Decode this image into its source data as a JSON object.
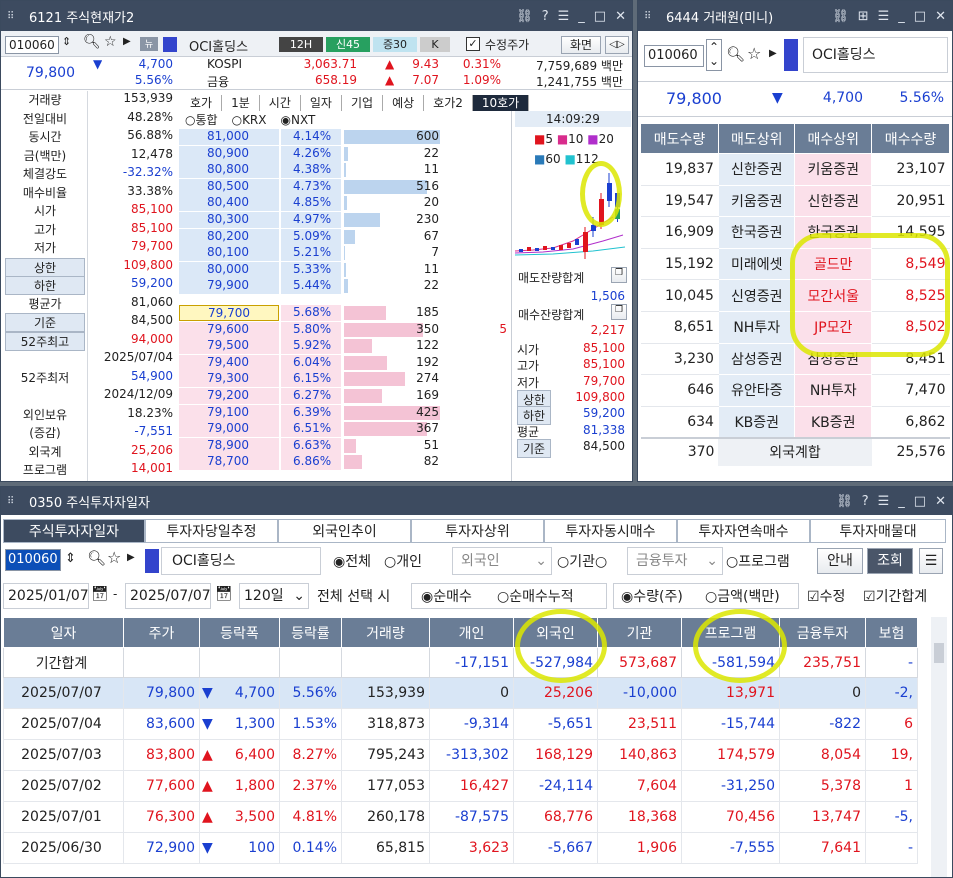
{
  "win1": {
    "title": "6121 주식현재가2",
    "code": "010060",
    "name": "OCI홀딩스",
    "tags": [
      "12H",
      "신45",
      "증30",
      "K"
    ],
    "adj_label": "수정주가",
    "screen_label": "화면",
    "price": "79,800",
    "change": "4,700",
    "change_rate": "5.56%",
    "index_rows": [
      {
        "name": "KOSPI",
        "value": "3,063.71",
        "chg": "9.43",
        "rate": "0.31%",
        "amt": "7,759,689 백만"
      },
      {
        "name": "금융",
        "value": "658.19",
        "chg": "7.07",
        "rate": "1.09%",
        "amt": "1,241,755 백만"
      }
    ],
    "left_info": [
      {
        "label": "거래량",
        "value": "153,939",
        "cls": ""
      },
      {
        "label": "전일대비",
        "value": "48.28%",
        "cls": ""
      },
      {
        "label": "동시간",
        "value": "56.88%",
        "cls": ""
      },
      {
        "label": "금(백만)",
        "value": "12,478",
        "cls": ""
      },
      {
        "label": "체결강도",
        "value": "-32.32%",
        "cls": "dn"
      },
      {
        "label": "매수비율",
        "value": "33.38%",
        "cls": ""
      },
      {
        "label": "시가",
        "value": "85,100",
        "cls": "up"
      },
      {
        "label": "고가",
        "value": "85,100",
        "cls": "up"
      },
      {
        "label": "저가",
        "value": "79,700",
        "cls": "up"
      },
      {
        "label": "상한",
        "value": "109,800",
        "cls": "up"
      },
      {
        "label": "하한",
        "value": "59,200",
        "cls": "dn"
      },
      {
        "label": "평균가",
        "value": "81,060",
        "cls": ""
      },
      {
        "label": "기준",
        "value": "84,500",
        "cls": ""
      },
      {
        "label": "52주최고",
        "value": "94,000",
        "cls": "up"
      },
      {
        "label": "",
        "value": "2025/07/04",
        "cls": ""
      },
      {
        "label": "52주최저",
        "value": "54,900",
        "cls": "dn"
      },
      {
        "label": "",
        "value": "2024/12/09",
        "cls": ""
      },
      {
        "label": "외인보유",
        "value": "18.23%",
        "cls": ""
      },
      {
        "label": "(증감)",
        "value": "-7,551",
        "cls": "dn"
      },
      {
        "label": "외국계",
        "value": "25,206",
        "cls": "up"
      },
      {
        "label": "프로그램",
        "value": "14,001",
        "cls": "up"
      }
    ],
    "tabs": [
      "호가",
      "1분",
      "시간",
      "일자",
      "기업",
      "예상",
      "호가2",
      "10호가"
    ],
    "radios": [
      "통합",
      "KRX",
      "NXT"
    ],
    "ask_rows": [
      {
        "price": "81,000",
        "rate": "4.14%",
        "qty": "600",
        "bar": 1.0
      },
      {
        "price": "80,900",
        "rate": "4.26%",
        "qty": "22",
        "bar": 0.04
      },
      {
        "price": "80,800",
        "rate": "4.38%",
        "qty": "11",
        "bar": 0.02
      },
      {
        "price": "80,500",
        "rate": "4.73%",
        "qty": "516",
        "bar": 0.86
      },
      {
        "price": "80,400",
        "rate": "4.85%",
        "qty": "20",
        "bar": 0.03
      },
      {
        "price": "80,300",
        "rate": "4.97%",
        "qty": "230",
        "bar": 0.38
      },
      {
        "price": "80,200",
        "rate": "5.09%",
        "qty": "67",
        "bar": 0.11
      },
      {
        "price": "80,100",
        "rate": "5.21%",
        "qty": "7",
        "bar": 0.01
      },
      {
        "price": "80,000",
        "rate": "5.33%",
        "qty": "11",
        "bar": 0.02
      },
      {
        "price": "79,900",
        "rate": "5.44%",
        "qty": "22",
        "bar": 0.04
      }
    ],
    "bid_rows": [
      {
        "price": "79,700",
        "rate": "5.68%",
        "qty": "185",
        "extra": "",
        "bar": 0.44
      },
      {
        "price": "79,600",
        "rate": "5.80%",
        "qty": "350",
        "extra": "5",
        "bar": 0.82
      },
      {
        "price": "79,500",
        "rate": "5.92%",
        "qty": "122",
        "extra": "",
        "bar": 0.29
      },
      {
        "price": "79,400",
        "rate": "6.04%",
        "qty": "192",
        "extra": "",
        "bar": 0.45
      },
      {
        "price": "79,300",
        "rate": "6.15%",
        "qty": "274",
        "extra": "",
        "bar": 0.64
      },
      {
        "price": "79,200",
        "rate": "6.27%",
        "qty": "169",
        "extra": "",
        "bar": 0.4
      },
      {
        "price": "79,100",
        "rate": "6.39%",
        "qty": "425",
        "extra": "",
        "bar": 1.0
      },
      {
        "price": "79,000",
        "rate": "6.51%",
        "qty": "367",
        "extra": "",
        "bar": 0.86
      },
      {
        "price": "78,900",
        "rate": "6.63%",
        "qty": "51",
        "extra": "",
        "bar": 0.12
      },
      {
        "price": "78,700",
        "rate": "6.86%",
        "qty": "82",
        "extra": "",
        "bar": 0.19
      }
    ],
    "time": "14:09:29",
    "legend1": [
      "5",
      "10",
      "20"
    ],
    "legend2": [
      "60",
      "112"
    ],
    "ask_total_label": "매도잔량합계",
    "ask_total": "1,506",
    "bid_total_label": "매수잔량합계",
    "bid_total": "2,217",
    "right_stats": [
      {
        "label": "시가",
        "value": "85,100"
      },
      {
        "label": "고가",
        "value": "85,100"
      },
      {
        "label": "저가",
        "value": "79,700"
      },
      {
        "label": "상한",
        "value": "109,800"
      },
      {
        "label": "하한",
        "value": "59,200"
      },
      {
        "label": "평균",
        "value": "81,338"
      },
      {
        "label": "기준",
        "value": "84,500"
      }
    ]
  },
  "win2": {
    "title": "6444 거래원(미니)",
    "code": "010060",
    "name": "OCI홀딩스",
    "price": "79,800",
    "change": "4,700",
    "change_rate": "5.56%",
    "headers": [
      "매도수량",
      "매도상위",
      "매수상위",
      "매수수량"
    ],
    "rows": [
      {
        "sq": "19,837",
        "sb": "신한증권",
        "bb": "키움증권",
        "bq": "23,107"
      },
      {
        "sq": "19,547",
        "sb": "키움증권",
        "bb": "신한증권",
        "bq": "20,951"
      },
      {
        "sq": "16,909",
        "sb": "한국증권",
        "bb": "한국증권",
        "bq": "14,595"
      },
      {
        "sq": "15,192",
        "sb": "미래에셋",
        "bb": "골드만",
        "bq": "8,549"
      },
      {
        "sq": "10,045",
        "sb": "신영증권",
        "bb": "모간서울",
        "bq": "8,525"
      },
      {
        "sq": "8,651",
        "sb": "NH투자",
        "bb": "JP모간",
        "bq": "8,502"
      },
      {
        "sq": "3,230",
        "sb": "삼성증권",
        "bb": "삼성증권",
        "bq": "8,451"
      },
      {
        "sq": "646",
        "sb": "유안타증",
        "bb": "NH투자",
        "bq": "7,470"
      },
      {
        "sq": "634",
        "sb": "KB증권",
        "bb": "KB증권",
        "bq": "6,862"
      }
    ],
    "footer_left": "370",
    "footer_label": "외국계합",
    "footer_right": "25,576"
  },
  "win3": {
    "title": "0350 주식투자자일자",
    "tabs": [
      "주식투자자일자",
      "투자자당일추정",
      "외국인추이",
      "투자자상위",
      "투자자동시매수",
      "투자자연속매수",
      "투자자매물대"
    ],
    "code": "010060",
    "name": "OCI홀딩스",
    "radios": [
      "전체",
      "개인"
    ],
    "foreign_select": "외국인",
    "radio_inst": "기관",
    "fin_select": "금융투자",
    "radio_prog": "프로그램",
    "guide": "안내",
    "search": "조회",
    "date_from": "2025/01/07",
    "date_to": "2025/07/07",
    "period": "120일",
    "select_label": "전체 선택 시",
    "r_net": "순매수",
    "r_cum": "순매수누적",
    "r_qty": "수량(주)",
    "r_amt": "금액(백만)",
    "chk_adj": "수정",
    "chk_period": "기간합계",
    "columns": [
      "일자",
      "주가",
      "등락폭",
      "등락률",
      "거래량",
      "개인",
      "외국인",
      "기관",
      "프로그램",
      "금융투자",
      "보험"
    ],
    "total_row": {
      "label": "기간합계",
      "personal": "-17,151",
      "foreign": "-527,984",
      "inst": "573,687",
      "program": "-581,594",
      "fin": "235,751",
      "ins": "-"
    },
    "rows": [
      {
        "date": "2025/07/07",
        "price": "79,800",
        "dir": "down",
        "chg": "4,700",
        "rate": "5.56%",
        "vol": "153,939",
        "personal": "0",
        "foreign": "25,206",
        "inst": "-10,000",
        "program": "13,971",
        "fin": "0",
        "ins": "-2,"
      },
      {
        "date": "2025/07/04",
        "price": "83,600",
        "dir": "down",
        "chg": "1,300",
        "rate": "1.53%",
        "vol": "318,873",
        "personal": "-9,314",
        "foreign": "-5,651",
        "inst": "23,511",
        "program": "-15,744",
        "fin": "-822",
        "ins": "6"
      },
      {
        "date": "2025/07/03",
        "price": "83,800",
        "dir": "up",
        "chg": "6,400",
        "rate": "8.27%",
        "vol": "795,243",
        "personal": "-313,302",
        "foreign": "168,129",
        "inst": "140,863",
        "program": "174,579",
        "fin": "8,054",
        "ins": "19,"
      },
      {
        "date": "2025/07/02",
        "price": "77,600",
        "dir": "up",
        "chg": "1,800",
        "rate": "2.37%",
        "vol": "177,053",
        "personal": "16,427",
        "foreign": "-24,114",
        "inst": "7,604",
        "program": "-31,250",
        "fin": "5,378",
        "ins": "1"
      },
      {
        "date": "2025/07/01",
        "price": "76,300",
        "dir": "up",
        "chg": "3,500",
        "rate": "4.81%",
        "vol": "260,178",
        "personal": "-87,575",
        "foreign": "68,776",
        "inst": "18,368",
        "program": "70,456",
        "fin": "13,747",
        "ins": "-5,"
      },
      {
        "date": "2025/06/30",
        "price": "72,900",
        "dir": "down",
        "chg": "100",
        "rate": "0.14%",
        "vol": "65,815",
        "personal": "3,623",
        "foreign": "-5,667",
        "inst": "1,906",
        "program": "-7,555",
        "fin": "7,641",
        "ins": "-"
      }
    ]
  }
}
